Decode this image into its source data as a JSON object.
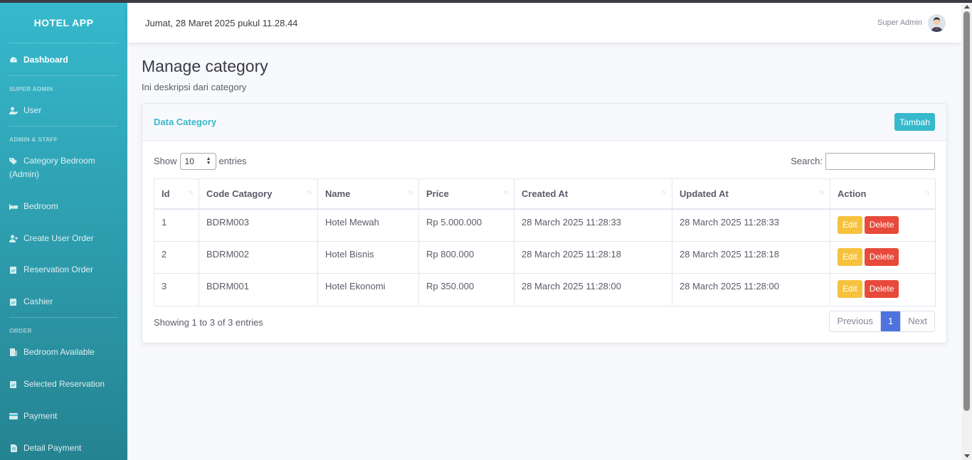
{
  "app": {
    "brand": "HOTEL APP"
  },
  "sidebar": {
    "dashboard": "Dashboard",
    "heading_super_admin": "SUPER ADMIN",
    "user": "User",
    "heading_admin_staff": "ADMIN & STAFF",
    "category_bedroom": "Category Bedroom (Admin)",
    "bedroom": "Bedroom",
    "create_user_order": "Create User Order",
    "reservation_order": "Reservation Order",
    "cashier": "Cashier",
    "heading_order": "ORDER",
    "bedroom_available": "Bedroom Available",
    "selected_reservation": "Selected Reservation",
    "payment": "Payment",
    "detail_payment": "Detail Payment"
  },
  "topbar": {
    "datetime": "Jumat, 28 Maret 2025 pukul 11.28.44",
    "user_name": "Super Admin"
  },
  "page": {
    "title": "Manage category",
    "description": "Ini deskripsi dari category"
  },
  "card": {
    "title": "Data Category",
    "add_button": "Tambah"
  },
  "datatable": {
    "show_label": "Show",
    "entries_value": "10",
    "entries_label": "entries",
    "search_label": "Search:",
    "search_value": "",
    "headers": [
      "Id",
      "Code Catagory",
      "Name",
      "Price",
      "Created At",
      "Updated At",
      "Action"
    ],
    "sort_icon": "↑↓",
    "rows": [
      [
        "1",
        "BDRM003",
        "Hotel Mewah",
        "Rp 5.000.000",
        "28 March 2025 11:28:33",
        "28 March 2025 11:28:33"
      ],
      [
        "2",
        "BDRM002",
        "Hotel Bisnis",
        "Rp 800.000",
        "28 March 2025 11:28:18",
        "28 March 2025 11:28:18"
      ],
      [
        "3",
        "BDRM001",
        "Hotel Ekonomi",
        "Rp 350.000",
        "28 March 2025 11:28:00",
        "28 March 2025 11:28:00"
      ]
    ],
    "edit_label": "Edit",
    "delete_label": "Delete",
    "info": "Showing 1 to 3 of 3 entries",
    "pager": {
      "previous": "Previous",
      "current": "1",
      "next": "Next"
    }
  },
  "colors": {
    "primary": "#36b9cc",
    "edit": "#f6c23e",
    "delete": "#e74a3b",
    "page_active": "#4e73df"
  }
}
